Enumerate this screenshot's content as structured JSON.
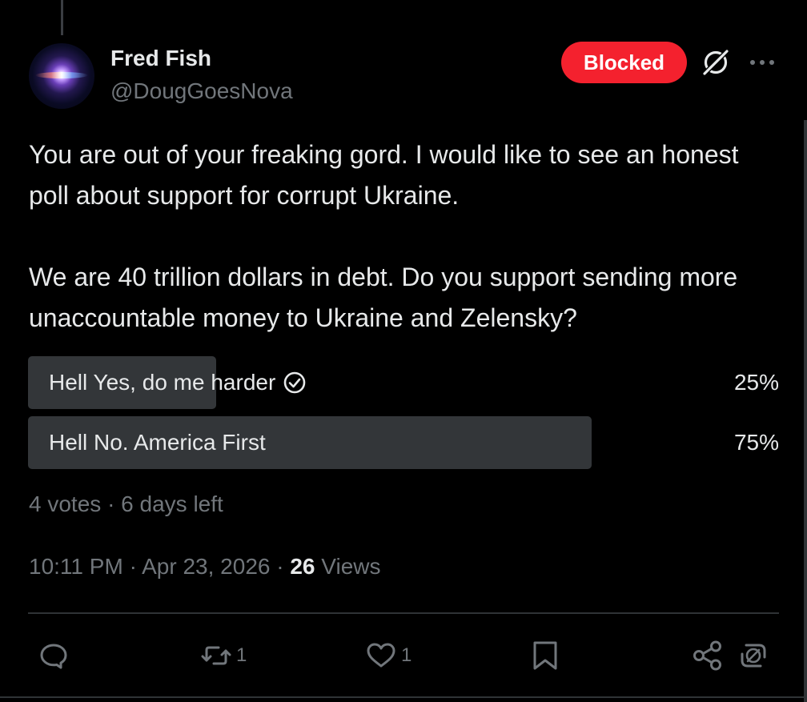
{
  "author": {
    "display_name": "Fred Fish",
    "handle": "@DougGoesNova",
    "avatar_icon": "nebula-avatar"
  },
  "header_actions": {
    "blocked_label": "Blocked",
    "blocked_color": "#f4212e",
    "grok_icon": "grok-icon",
    "more_icon": "more-icon"
  },
  "post": {
    "paragraphs": [
      "You are out of your freaking gord.   I would like to see an honest poll about support for corrupt Ukraine.",
      "We are 40 trillion dollars in debt.  Do you support sending more unaccountable money to Ukraine and Zelensky?"
    ]
  },
  "poll": {
    "options": [
      {
        "label": "Hell Yes, do me harder",
        "percent_text": "25%",
        "fraction": 0.25,
        "selected": true
      },
      {
        "label": "Hell No.  America First",
        "percent_text": "75%",
        "fraction": 0.75,
        "selected": false
      }
    ],
    "votes": "4 votes",
    "separator": "·",
    "time_left": "6 days left"
  },
  "meta": {
    "time": "10:11 PM",
    "separator": "·",
    "date": "Apr 23, 2026",
    "views_count": "26",
    "views_label": "Views"
  },
  "actions": {
    "reply_count": "",
    "repost_count": "1",
    "like_count": "1",
    "icons": [
      "reply-icon",
      "repost-icon",
      "like-icon",
      "bookmark-icon",
      "share-icon",
      "grok-analyze-icon"
    ]
  },
  "colors": {
    "background": "#000000",
    "text_primary": "#e7e9ea",
    "text_secondary": "#71767b",
    "poll_fill": "#333639",
    "divider": "#2f3336"
  }
}
